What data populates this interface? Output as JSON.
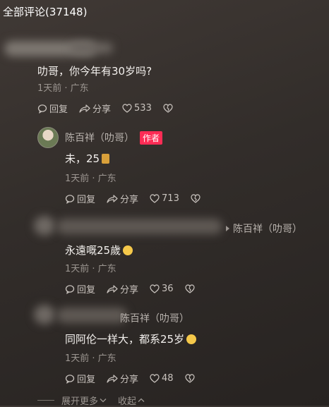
{
  "header": {
    "title": "全部评论(37148)"
  },
  "comments": [
    {
      "text": "叻哥，你今年有30岁吗?",
      "meta": "1天前 · 广东",
      "reply_label": "回复",
      "share_label": "分享",
      "likes": "533"
    }
  ],
  "replies": [
    {
      "author": "陈百祥（叻哥）",
      "badge": "作者",
      "text": "未，25",
      "meta": "1天前 · 广东",
      "reply_label": "回复",
      "share_label": "分享",
      "likes": "713"
    },
    {
      "reply_to": "陈百祥（叻哥）",
      "text": "永遠嘅25歲",
      "meta": "1天前 · 广东",
      "reply_label": "回复",
      "share_label": "分享",
      "likes": "36"
    },
    {
      "reply_to": "陈百祥（叻哥）",
      "text": "同阿伦一样大，都系25岁",
      "meta": "1天前 · 广东",
      "reply_label": "回复",
      "share_label": "分享",
      "likes": "48"
    }
  ],
  "footer": {
    "expand_label": "展开更多",
    "collapse_label": "收起"
  },
  "colors": {
    "badge": "#fe2c55",
    "background": "#322d2a"
  }
}
